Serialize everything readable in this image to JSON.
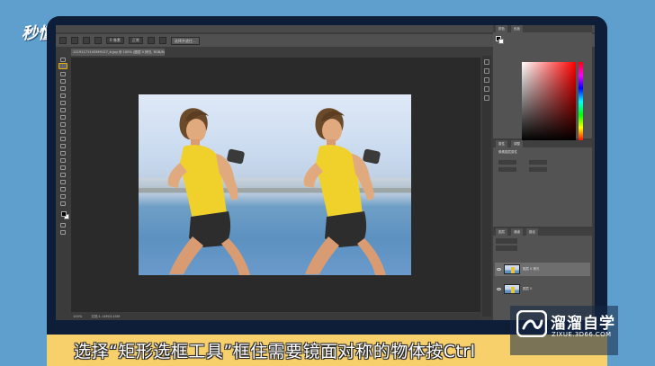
{
  "logo": {
    "text": "秒懂视频"
  },
  "photoshop": {
    "options": {
      "feather_value": "0 像素",
      "style_value": "正常",
      "refine_button": "选择并遮住..."
    },
    "document_tab": "11191171143369127_b.jpg @ 100% (图层 0 拷贝, RGB/8) *",
    "status": {
      "zoom": "100%",
      "doc_size": "文档:1.14M/3.45M"
    },
    "panels": {
      "color_tabs": [
        "颜色",
        "色板"
      ],
      "properties_tabs": [
        "属性",
        "调整"
      ],
      "properties_title": "像素图层属性",
      "layers_tabs": [
        "图层",
        "通道",
        "路径"
      ],
      "layers": [
        {
          "name": "图层 0 拷贝",
          "selected": true
        },
        {
          "name": "图层 0",
          "selected": false
        }
      ]
    }
  },
  "subtitle": "选择“矩形选框工具”框住需要镜面对称的物体按Ctrl",
  "watermark": {
    "title": "溜溜自学",
    "url": "ZIXUE.3D66.COM"
  }
}
